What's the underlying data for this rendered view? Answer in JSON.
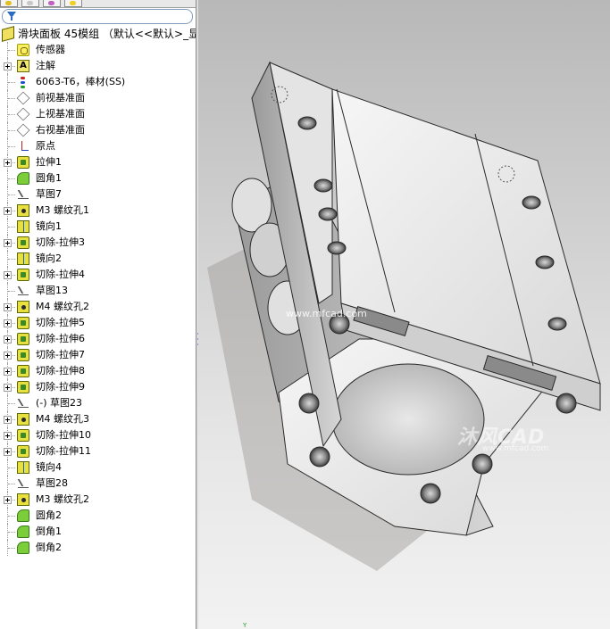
{
  "tree": {
    "filter_icon": "filter-funnel-icon",
    "items": [
      {
        "label": "滑块面板 45模组 （默认<<默认>_显示",
        "icon": "part",
        "expand": false,
        "root": true
      },
      {
        "label": "传感器",
        "icon": "sensor",
        "expand": false
      },
      {
        "label": "注解",
        "icon": "annotation",
        "expand": true
      },
      {
        "label": "6063-T6，棒材(SS)",
        "icon": "material",
        "expand": false
      },
      {
        "label": "前视基准面",
        "icon": "plane",
        "expand": false
      },
      {
        "label": "上视基准面",
        "icon": "plane",
        "expand": false
      },
      {
        "label": "右视基准面",
        "icon": "plane",
        "expand": false
      },
      {
        "label": "原点",
        "icon": "origin",
        "expand": false
      },
      {
        "label": "拉伸1",
        "icon": "extrude",
        "expand": true
      },
      {
        "label": "圆角1",
        "icon": "fillet",
        "expand": false
      },
      {
        "label": "草图7",
        "icon": "sketch",
        "expand": false
      },
      {
        "label": "M3 螺纹孔1",
        "icon": "hole",
        "expand": true
      },
      {
        "label": "镜向1",
        "icon": "mirror",
        "expand": false
      },
      {
        "label": "切除-拉伸3",
        "icon": "cut",
        "expand": true
      },
      {
        "label": "镜向2",
        "icon": "mirror",
        "expand": false
      },
      {
        "label": "切除-拉伸4",
        "icon": "cut",
        "expand": true
      },
      {
        "label": "草图13",
        "icon": "sketch",
        "expand": false
      },
      {
        "label": "M4 螺纹孔2",
        "icon": "hole",
        "expand": true
      },
      {
        "label": "切除-拉伸5",
        "icon": "cut",
        "expand": true
      },
      {
        "label": "切除-拉伸6",
        "icon": "cut",
        "expand": true
      },
      {
        "label": "切除-拉伸7",
        "icon": "cut",
        "expand": true
      },
      {
        "label": "切除-拉伸8",
        "icon": "cut",
        "expand": true
      },
      {
        "label": "切除-拉伸9",
        "icon": "cut",
        "expand": true
      },
      {
        "label": "(-) 草图23",
        "icon": "sketch",
        "expand": false
      },
      {
        "label": "M4 螺纹孔3",
        "icon": "hole",
        "expand": true
      },
      {
        "label": "切除-拉伸10",
        "icon": "cut",
        "expand": true
      },
      {
        "label": "切除-拉伸11",
        "icon": "cut",
        "expand": true
      },
      {
        "label": "镜向4",
        "icon": "mirror",
        "expand": false
      },
      {
        "label": "草图28",
        "icon": "sketch",
        "expand": false
      },
      {
        "label": "M3 螺纹孔2",
        "icon": "hole",
        "expand": true
      },
      {
        "label": "圆角2",
        "icon": "fillet",
        "expand": false
      },
      {
        "label": "倒角1",
        "icon": "fillet",
        "expand": false
      },
      {
        "label": "倒角2",
        "icon": "fillet",
        "expand": false
      }
    ]
  },
  "viewport": {
    "watermark_brand": "沐风CAD",
    "watermark_url": "www.mfcad.com",
    "watermark_url_center": "www.mfcad.com",
    "triad_label": "Y"
  }
}
